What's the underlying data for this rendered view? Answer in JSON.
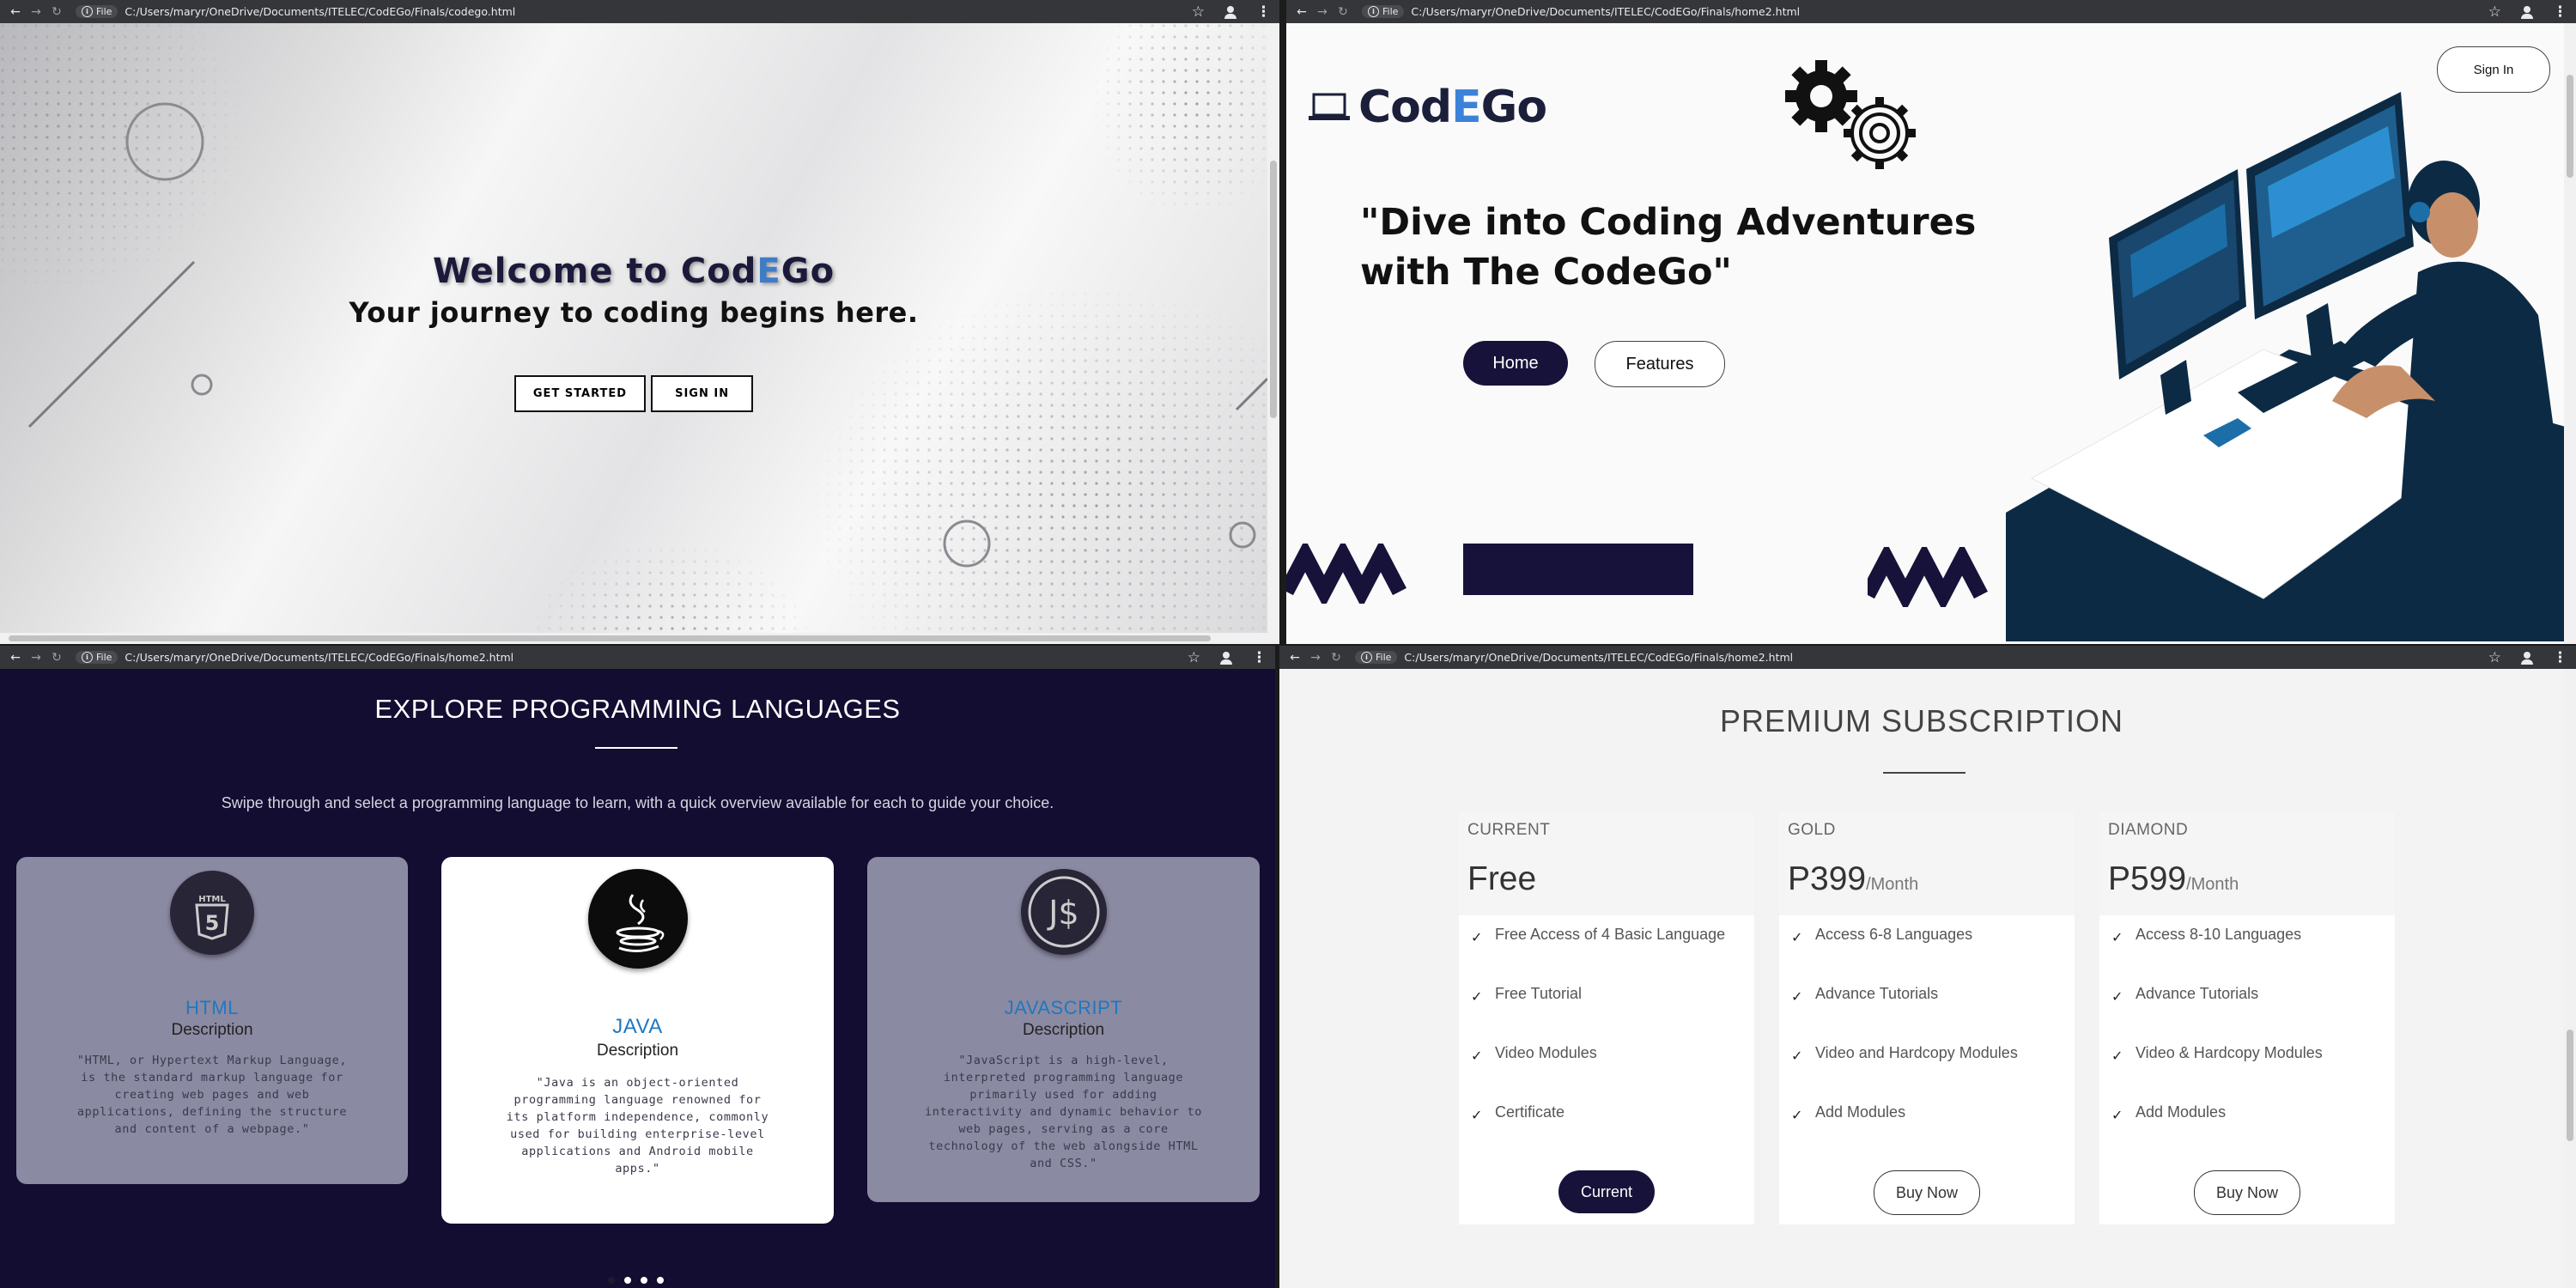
{
  "windows": [
    {
      "url": "C:/Users/maryr/OneDrive/Documents/ITELEC/CodEGo/Finals/codego.html"
    },
    {
      "url": "C:/Users/maryr/OneDrive/Documents/ITELEC/CodEGo/Finals/home2.html"
    },
    {
      "url": "C:/Users/maryr/OneDrive/Documents/ITELEC/CodEGo/Finals/home2.html"
    },
    {
      "url": "C:/Users/maryr/OneDrive/Documents/ITELEC/CodEGo/Finals/home2.html"
    }
  ],
  "chrome": {
    "file_label": "File",
    "info_glyph": "i",
    "back_glyph": "←",
    "forward_glyph": "→",
    "reload_glyph": "↻",
    "star_glyph": "☆",
    "menu_glyph": "⋮"
  },
  "welcome": {
    "title_pre": "Welcome to Cod",
    "title_hl": "E",
    "title_post": "Go",
    "subtitle": "Your journey to coding begins here.",
    "get_started": "GET STARTED",
    "sign_in": "SIGN IN"
  },
  "home": {
    "logo_pre": "Cod",
    "logo_hl": "E",
    "logo_post": "Go",
    "headline_line1": "\"Dive into Coding Adventures",
    "headline_line2": "with The CodeGo\"",
    "sign_in": "Sign In",
    "home_btn": "Home",
    "features_btn": "Features",
    "accent": "#16123a",
    "brand_blue": "#3b82d8"
  },
  "languages": {
    "heading": "EXPLORE PROGRAMMING LANGUAGES",
    "description": "Swipe through and select a programming language to learn, with a quick overview available for each to guide your choice.",
    "cards": [
      {
        "icon": "html5-icon",
        "icon_text": "HTML",
        "name": "HTML",
        "sub": "Description",
        "body": "\"HTML, or Hypertext Markup Language, is the standard markup language for creating web pages and web applications, defining the structure and content of a webpage.\""
      },
      {
        "icon": "java-icon",
        "name": "JAVA",
        "sub": "Description",
        "body": "\"Java is an object-oriented programming language renowned for its platform independence, commonly used for building enterprise-level applications and Android mobile apps.\""
      },
      {
        "icon": "javascript-icon",
        "icon_text": "J$",
        "name": "JAVASCRIPT",
        "sub": "Description",
        "body": "\"JavaScript is a high-level, interpreted programming language primarily used for adding interactivity and dynamic behavior to web pages, serving as a core technology of the web alongside HTML and CSS.\""
      }
    ],
    "active_dot": 1,
    "dot_count": 4
  },
  "subscription": {
    "heading": "PREMIUM SUBSCRIPTION",
    "check_glyph": "✓",
    "plans": [
      {
        "label": "CURRENT",
        "price": "Free",
        "per": "",
        "features": [
          "Free Access of 4 Basic Language",
          "Free Tutorial",
          "Video Modules",
          "Certificate"
        ],
        "button": "Current"
      },
      {
        "label": "GOLD",
        "price": "P399",
        "per": "/Month",
        "features": [
          "Access 6-8 Languages",
          "Advance Tutorials",
          "Video and Hardcopy Modules",
          "Add Modules"
        ],
        "button": "Buy Now"
      },
      {
        "label": "DIAMOND",
        "price": "P599",
        "per": "/Month",
        "features": [
          "Access 8-10 Languages",
          "Advance Tutorials",
          "Video & Hardcopy Modules",
          "Add Modules"
        ],
        "button": "Buy Now"
      }
    ]
  }
}
